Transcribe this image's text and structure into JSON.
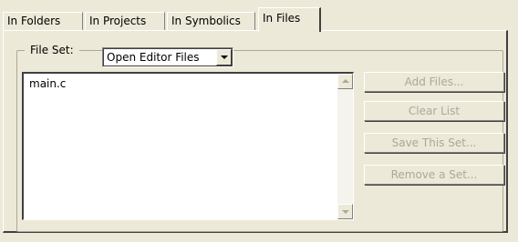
{
  "tabs": [
    {
      "label": "In Folders",
      "active": false
    },
    {
      "label": "In Projects",
      "active": false
    },
    {
      "label": "In Symbolics",
      "active": false
    },
    {
      "label": "In Files",
      "active": true
    }
  ],
  "file_set": {
    "label": "File Set:",
    "selected": "Open Editor Files"
  },
  "file_list": {
    "items": [
      "main.c"
    ]
  },
  "buttons": {
    "add_files": "Add Files...",
    "clear_list": "Clear List",
    "save_set": "Save This Set...",
    "remove_set": "Remove a Set..."
  },
  "colors": {
    "face": "#ece9d8",
    "disabled_text": "#aca899"
  },
  "icons": {
    "combo": "chevron-down-icon",
    "scroll_up": "arrow-up-icon",
    "scroll_down": "arrow-down-icon"
  }
}
